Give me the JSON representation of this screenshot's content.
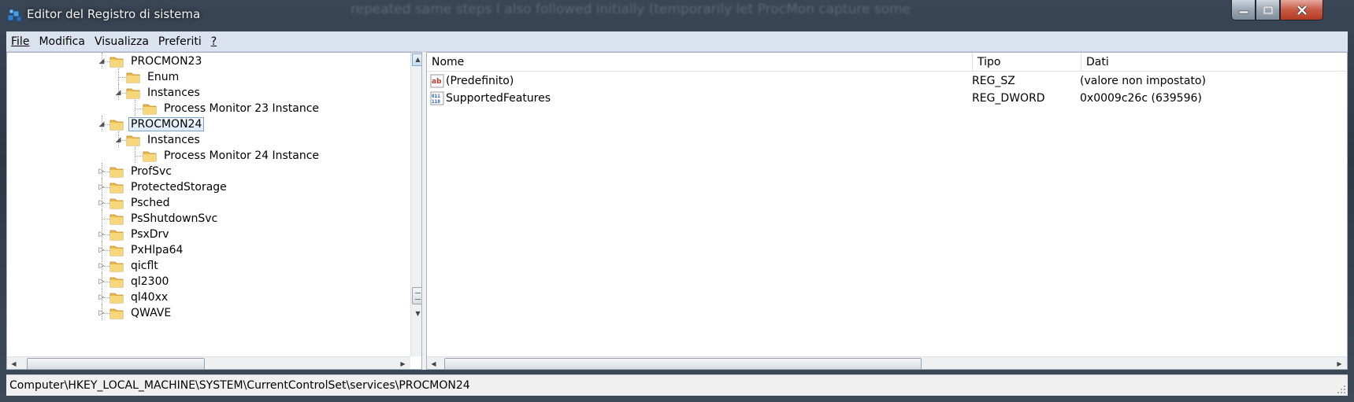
{
  "window": {
    "title": "Editor del Registro di sistema",
    "background_text": "repeated same steps I also followed initially (temporarily let ProcMon capture some"
  },
  "menu": [
    "File",
    "Modifica",
    "Visualizza",
    "Preferiti",
    "?"
  ],
  "tree": {
    "items": [
      {
        "label": "PROCMON23",
        "level": 0,
        "expander": "expanded",
        "selected": false
      },
      {
        "label": "Enum",
        "level": 1,
        "expander": "none",
        "selected": false
      },
      {
        "label": "Instances",
        "level": 1,
        "expander": "expanded",
        "selected": false
      },
      {
        "label": "Process Monitor 23 Instance",
        "level": 2,
        "expander": "none",
        "selected": false
      },
      {
        "label": "PROCMON24",
        "level": 0,
        "expander": "expanded",
        "selected": true
      },
      {
        "label": "Instances",
        "level": 1,
        "expander": "expanded",
        "selected": false
      },
      {
        "label": "Process Monitor 24 Instance",
        "level": 2,
        "expander": "none",
        "selected": false
      },
      {
        "label": "ProfSvc",
        "level": 0,
        "expander": "collapsed",
        "selected": false
      },
      {
        "label": "ProtectedStorage",
        "level": 0,
        "expander": "collapsed",
        "selected": false
      },
      {
        "label": "Psched",
        "level": 0,
        "expander": "collapsed",
        "selected": false
      },
      {
        "label": "PsShutdownSvc",
        "level": 0,
        "expander": "none",
        "selected": false
      },
      {
        "label": "PsxDrv",
        "level": 0,
        "expander": "collapsed",
        "selected": false
      },
      {
        "label": "PxHlpa64",
        "level": 0,
        "expander": "collapsed",
        "selected": false
      },
      {
        "label": "qicflt",
        "level": 0,
        "expander": "collapsed",
        "selected": false
      },
      {
        "label": "ql2300",
        "level": 0,
        "expander": "collapsed",
        "selected": false
      },
      {
        "label": "ql40xx",
        "level": 0,
        "expander": "collapsed",
        "selected": false
      },
      {
        "label": "QWAVE",
        "level": 0,
        "expander": "collapsed",
        "selected": false
      }
    ]
  },
  "values": {
    "columns": [
      "Nome",
      "Tipo",
      "Dati"
    ],
    "rows": [
      {
        "icon": "string-value-icon",
        "name": "(Predefinito)",
        "type": "REG_SZ",
        "data": "(valore non impostato)"
      },
      {
        "icon": "binary-value-icon",
        "name": "SupportedFeatures",
        "type": "REG_DWORD",
        "data": "0x0009c26c (639596)"
      }
    ]
  },
  "statusbar": {
    "path": "Computer\\HKEY_LOCAL_MACHINE\\SYSTEM\\CurrentControlSet\\services\\PROCMON24"
  },
  "colors": {
    "selection_border": "#7da2ce",
    "menubar_bg": "#dbe4ee",
    "close_button": "#c85a45",
    "folder_yellow": "#f2c94c"
  }
}
